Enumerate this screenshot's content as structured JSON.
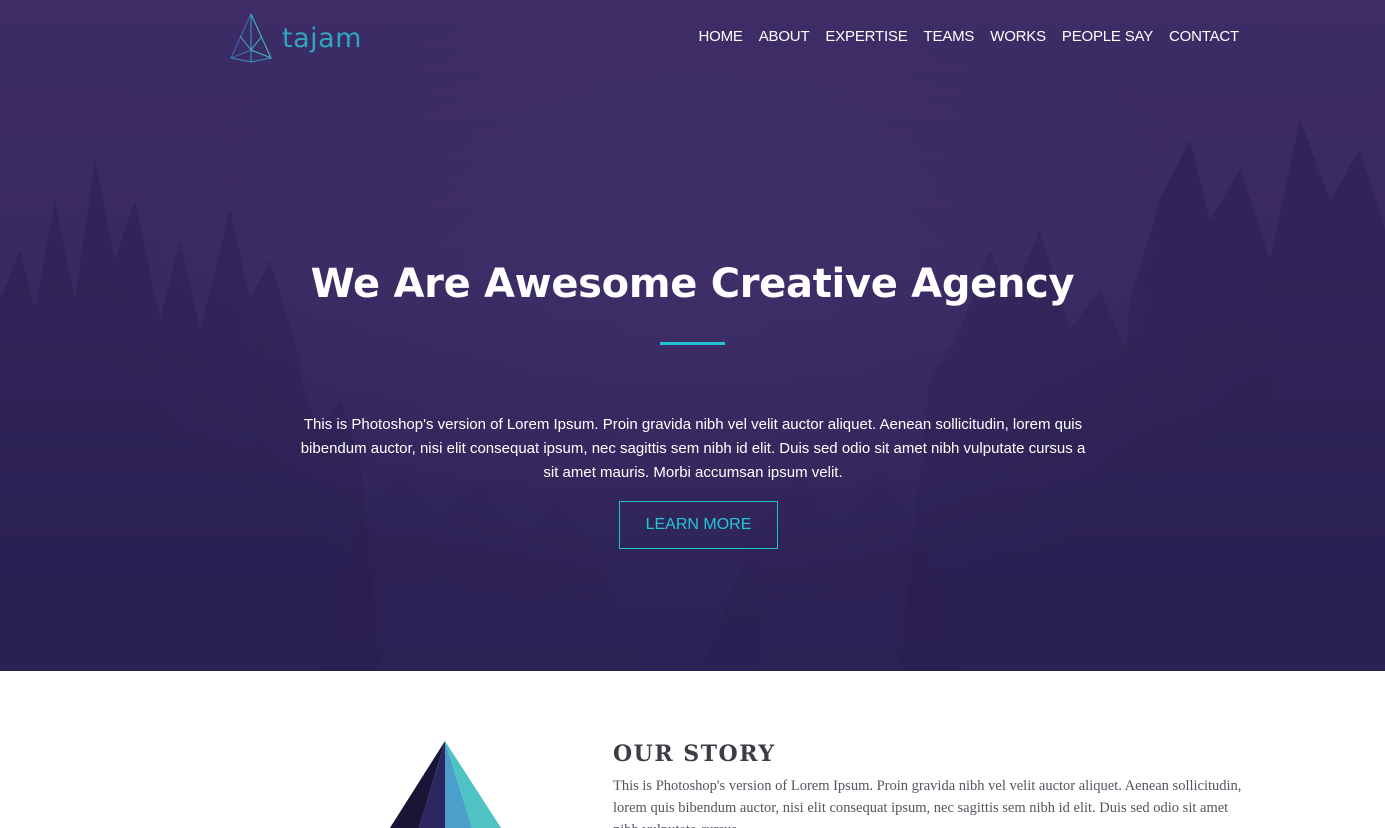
{
  "brand": {
    "name": "tajam"
  },
  "nav": {
    "items": [
      {
        "label": "HOME"
      },
      {
        "label": "ABOUT"
      },
      {
        "label": "EXPERTISE"
      },
      {
        "label": "TEAMS"
      },
      {
        "label": "WORKS"
      },
      {
        "label": "PEOPLE SAY"
      },
      {
        "label": "CONTACT"
      }
    ]
  },
  "hero": {
    "title": "We Are Awesome Creative Agency",
    "text": "This is Photoshop's version of Lorem Ipsum. Proin gravida nibh vel velit auctor aliquet. Aenean sollicitudin, lorem quis bibendum auctor, nisi elit consequat ipsum, nec sagittis sem nibh id elit. Duis sed odio sit amet nibh vulputate cursus a sit amet mauris. Morbi accumsan ipsum velit.",
    "button_label": "LEARN MORE"
  },
  "story": {
    "title": "OUR STORY",
    "text": "This is Photoshop's version of Lorem Ipsum. Proin gravida nibh vel velit auctor aliquet. Aenean sollicitudin, lorem quis bibendum auctor, nisi elit consequat ipsum, nec sagittis sem nibh id elit. Duis sed odio sit amet nibh vulputate cursus."
  },
  "colors": {
    "hero_bg": "#3a2a62",
    "accent": "#22c3d3",
    "text_light": "#ffffff",
    "heading_dark": "#3d3d46"
  },
  "icons": {
    "logo": "pyramid-logo-icon",
    "story_image": "pyramid-illustration-icon"
  }
}
